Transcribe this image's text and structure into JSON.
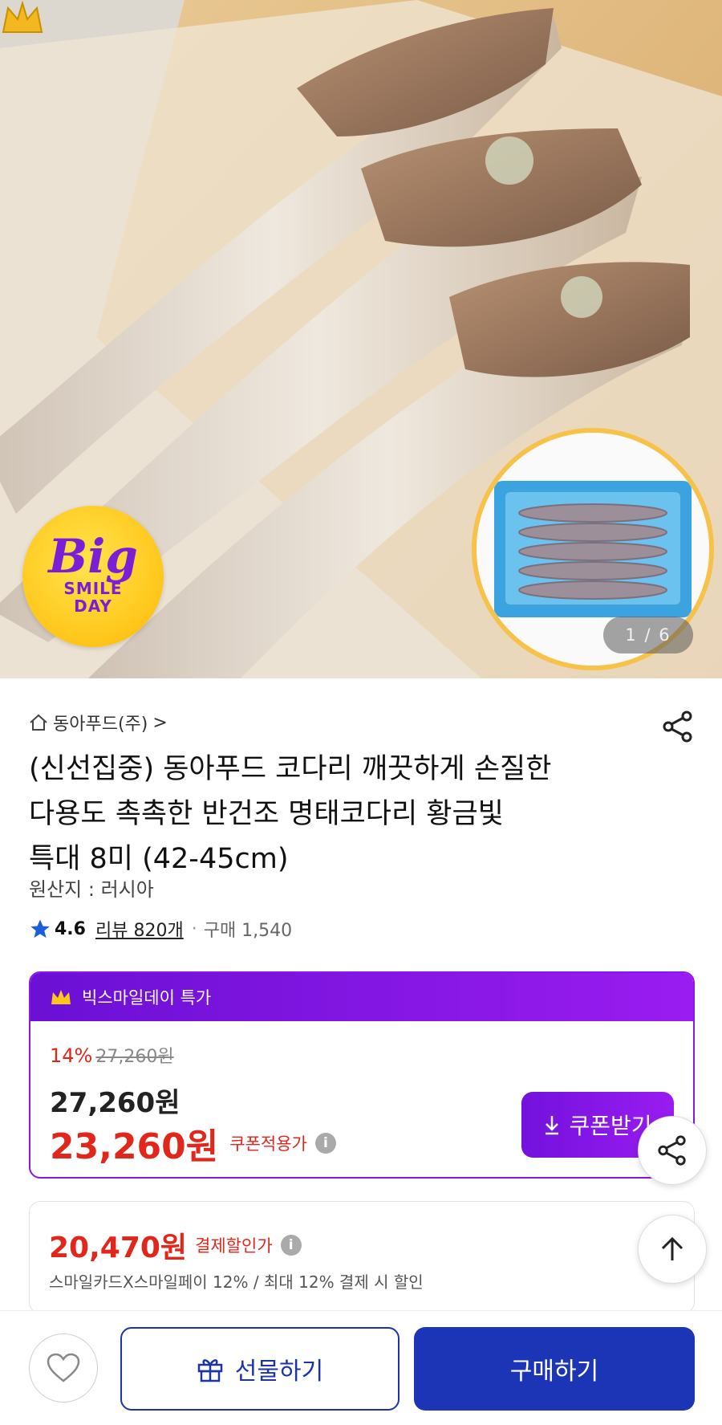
{
  "hero": {
    "badge_big": "Big",
    "badge_smile": "SMILE",
    "badge_day": "DAY",
    "image_counter": "1 / 6"
  },
  "seller": {
    "name": "동아푸드(주)",
    "chevron": ">"
  },
  "product": {
    "title_line1": "(신선집중) 동아푸드 코다리 깨끗하게 손질한",
    "title_line2": "다용도 촉촉한 반건조 명태코다리 황금빛",
    "title_line3": "특대 8미 (42-45cm)",
    "origin": "원산지 : 러시아",
    "rating": "4.6",
    "reviews": "리뷰 820개",
    "purchases": "구매 1,540"
  },
  "deal": {
    "header": "빅스마일데이 특가",
    "discount_rate": "14%",
    "original_price": "27,260원",
    "sale_price": "27,260원",
    "coupon_price": "23,260원",
    "coupon_label": "쿠폰적용가",
    "coupon_button": "쿠폰받기"
  },
  "payment": {
    "price": "20,470원",
    "label": "결제할인가",
    "note": "스마일카드X스마일페이 12% / 최대 12% 결제 시 할인"
  },
  "bottom": {
    "gift": "선물하기",
    "buy": "구매하기"
  },
  "colors": {
    "accent_purple": "#8a16e8",
    "price_red": "#e1261c",
    "brand_blue": "#1c34b6",
    "star_blue": "#1a5fd8"
  },
  "icons": [
    "home-icon",
    "share-icon",
    "star-icon",
    "crown-icon",
    "info-icon",
    "download-icon",
    "heart-icon",
    "gift-icon",
    "arrow-up-icon"
  ]
}
